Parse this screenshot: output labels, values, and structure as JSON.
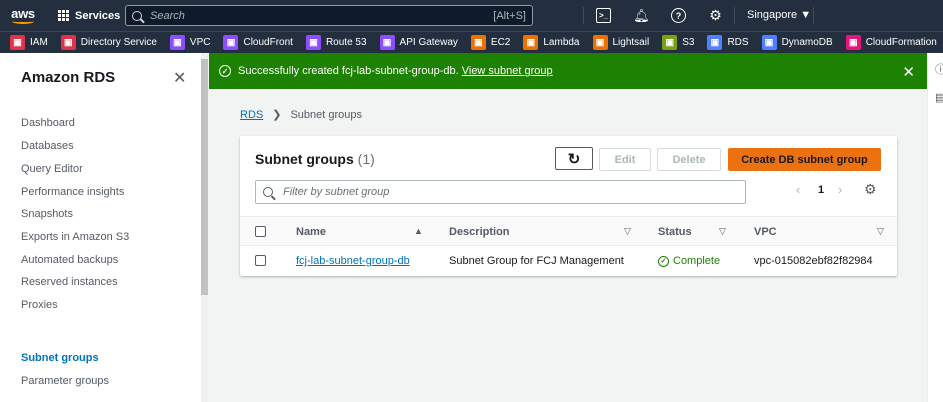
{
  "topnav": {
    "logo": "aws",
    "services": "Services",
    "search_placeholder": "Search",
    "search_shortcut": "[Alt+S]",
    "region": "Singapore ▼"
  },
  "favorites": [
    {
      "label": "IAM",
      "color": "#dd344c",
      "icon": "iam-icon"
    },
    {
      "label": "Directory Service",
      "color": "#dd344c",
      "icon": "directory-service-icon"
    },
    {
      "label": "VPC",
      "color": "#8c4fff",
      "icon": "vpc-icon"
    },
    {
      "label": "CloudFront",
      "color": "#8c4fff",
      "icon": "cloudfront-icon"
    },
    {
      "label": "Route 53",
      "color": "#8c4fff",
      "icon": "route53-icon"
    },
    {
      "label": "API Gateway",
      "color": "#8c4fff",
      "icon": "api-gateway-icon"
    },
    {
      "label": "EC2",
      "color": "#ed7100",
      "icon": "ec2-icon"
    },
    {
      "label": "Lambda",
      "color": "#ed7100",
      "icon": "lambda-icon"
    },
    {
      "label": "Lightsail",
      "color": "#ed7100",
      "icon": "lightsail-icon"
    },
    {
      "label": "S3",
      "color": "#7aa116",
      "icon": "s3-icon"
    },
    {
      "label": "RDS",
      "color": "#527fff",
      "icon": "rds-icon"
    },
    {
      "label": "DynamoDB",
      "color": "#527fff",
      "icon": "dynamodb-icon"
    },
    {
      "label": "CloudFormation",
      "color": "#e7157b",
      "icon": "cloudformation-icon"
    }
  ],
  "sidenav": {
    "title": "Amazon RDS",
    "items": [
      "Dashboard",
      "Databases",
      "Query Editor",
      "Performance insights",
      "Snapshots",
      "Exports in Amazon S3",
      "Automated backups",
      "Reserved instances",
      "Proxies",
      "Subnet groups",
      "Parameter groups"
    ],
    "active_index": 9
  },
  "flash": {
    "message": "Successfully created fcj-lab-subnet-group-db.",
    "link": "View subnet group"
  },
  "breadcrumb": {
    "root": "RDS",
    "current": "Subnet groups"
  },
  "panel": {
    "title": "Subnet groups",
    "count": "(1)",
    "edit": "Edit",
    "delete": "Delete",
    "create": "Create DB subnet group",
    "filter_placeholder": "Filter by subnet group",
    "page": "1"
  },
  "table": {
    "columns": [
      "Name",
      "Description",
      "Status",
      "VPC"
    ],
    "rows": [
      {
        "name": "fcj-lab-subnet-group-db",
        "description": "Subnet Group for FCJ Management",
        "status": "Complete",
        "vpc": "vpc-015082ebf82f82984"
      }
    ]
  }
}
